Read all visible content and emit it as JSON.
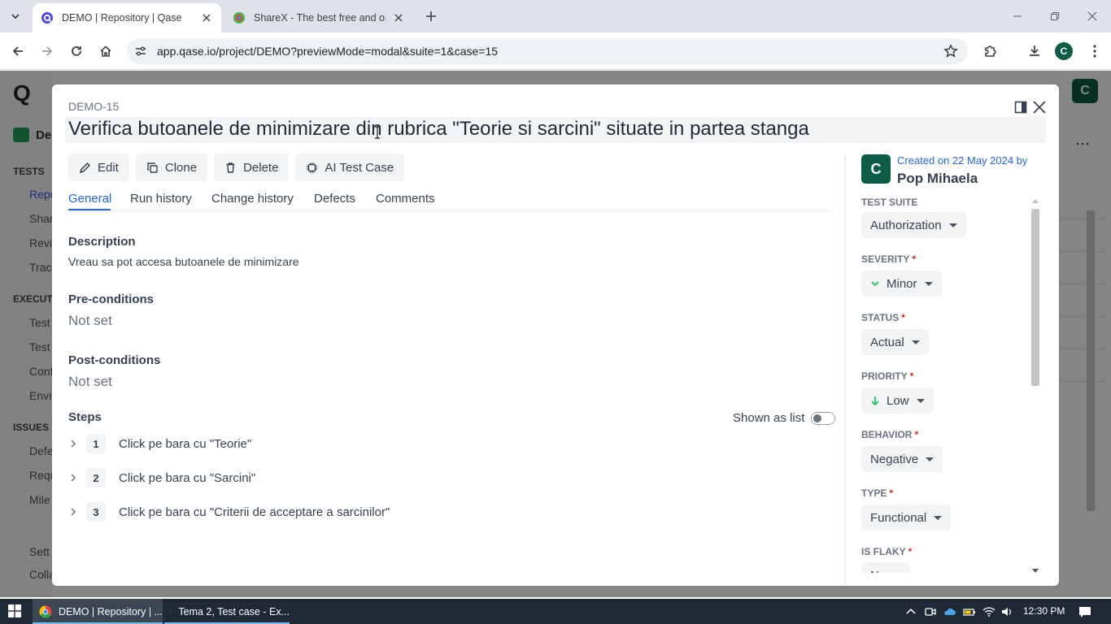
{
  "browser": {
    "tabs": [
      {
        "title": "DEMO | Repository | Qase",
        "active": true
      },
      {
        "title": "ShareX - The best free and ope",
        "active": false
      }
    ],
    "url": "app.qase.io/project/DEMO?previewMode=modal&suite=1&case=15",
    "profile_initial": "C"
  },
  "app_background": {
    "user_initial": "C",
    "sidebar": {
      "project_short": "De",
      "sections": [
        {
          "heading": "TESTS",
          "items": [
            "Repo",
            "Shar",
            "Revi",
            "Trac"
          ]
        },
        {
          "heading": "EXECUTI",
          "items": [
            "Test",
            "Test",
            "Conf",
            "Envi"
          ]
        },
        {
          "heading": "ISSUES",
          "items": [
            "Defe",
            "Requ",
            "Mile"
          ]
        }
      ],
      "bottom": [
        "Sett",
        "Colla"
      ]
    }
  },
  "modal": {
    "case_code": "DEMO-15",
    "title": "Verifica butoanele de minimizare din rubrica \"Teorie si sarcini\" situate in partea stanga",
    "actions": [
      "Edit",
      "Clone",
      "Delete",
      "AI Test Case"
    ],
    "tabs": [
      "General",
      "Run history",
      "Change history",
      "Defects",
      "Comments"
    ],
    "active_tab": "General",
    "description": {
      "label": "Description",
      "value": "Vreau sa pot accesa butoanele de minimizare"
    },
    "preconditions": {
      "label": "Pre-conditions",
      "value": "Not set"
    },
    "postconditions": {
      "label": "Post-conditions",
      "value": "Not set"
    },
    "steps": {
      "label": "Steps",
      "toggle_label": "Shown as list",
      "toggle_on": false,
      "items": [
        {
          "num": "1",
          "text": "Click pe bara cu \"Teorie\""
        },
        {
          "num": "2",
          "text": "Click pe bara cu \"Sarcini\""
        },
        {
          "num": "3",
          "text": "Click pe bara cu \"Criterii de acceptare a sarcinilor\""
        }
      ]
    },
    "meta": {
      "author_initial": "C",
      "created": "Created on 22 May 2024 by",
      "author": "Pop Mihaela"
    },
    "properties": [
      {
        "label": "TEST SUITE",
        "required": false,
        "value": "Authorization"
      },
      {
        "label": "SEVERITY",
        "required": true,
        "value": "Minor",
        "icon": "chevron-down-green"
      },
      {
        "label": "STATUS",
        "required": true,
        "value": "Actual"
      },
      {
        "label": "PRIORITY",
        "required": true,
        "value": "Low",
        "icon": "arrow-down-green"
      },
      {
        "label": "BEHAVIOR",
        "required": true,
        "value": "Negative"
      },
      {
        "label": "TYPE",
        "required": true,
        "value": "Functional"
      },
      {
        "label": "IS FLAKY",
        "required": true,
        "value": "No"
      }
    ],
    "required_mark": "*"
  },
  "taskbar": {
    "items": [
      {
        "label": "DEMO | Repository | ...",
        "app": "chrome"
      },
      {
        "label": "Tema 2, Test case - Ex...",
        "app": "excel"
      }
    ],
    "time": "12:30 PM"
  },
  "colors": {
    "accent": "#2563eb",
    "brand": "#0d5c46",
    "required": "#dc2626",
    "green": "#22c55e"
  }
}
